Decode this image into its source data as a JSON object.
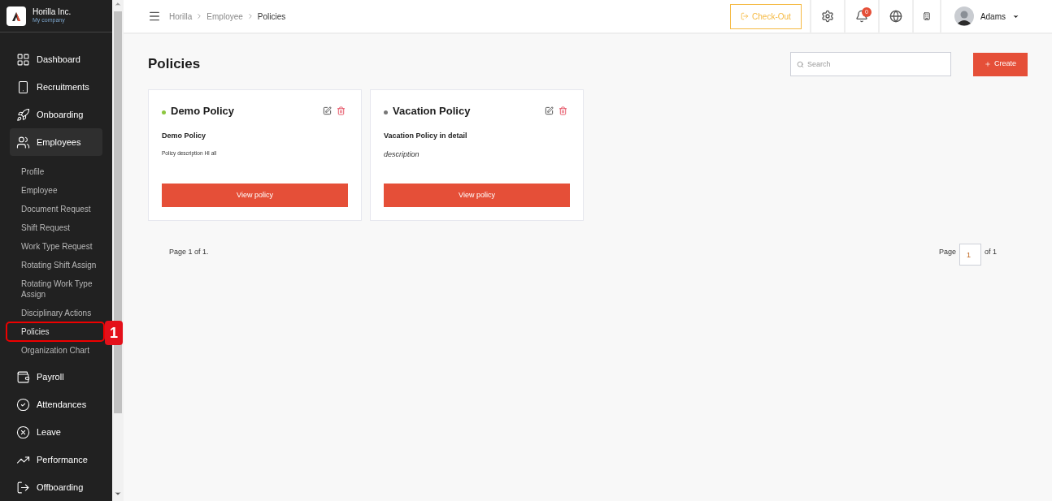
{
  "company": {
    "name": "Horilla Inc.",
    "subtitle": "My company"
  },
  "nav": [
    {
      "label": "Dashboard",
      "expanded": false
    },
    {
      "label": "Recruitments",
      "expanded": false
    },
    {
      "label": "Onboarding",
      "expanded": false
    },
    {
      "label": "Employees",
      "expanded": true,
      "children": [
        {
          "label": "Profile",
          "selected": false
        },
        {
          "label": "Employee",
          "selected": false
        },
        {
          "label": "Document Request",
          "selected": false
        },
        {
          "label": "Shift Request",
          "selected": false
        },
        {
          "label": "Work Type Request",
          "selected": false
        },
        {
          "label": "Rotating Shift Assign",
          "selected": false
        },
        {
          "label": "Rotating Work Type Assign",
          "selected": false
        },
        {
          "label": "Disciplinary Actions",
          "selected": false
        },
        {
          "label": "Policies",
          "selected": true,
          "callout": "1"
        },
        {
          "label": "Organization Chart",
          "selected": false
        }
      ]
    },
    {
      "label": "Payroll",
      "expanded": false
    },
    {
      "label": "Attendances",
      "expanded": false
    },
    {
      "label": "Leave",
      "expanded": false
    },
    {
      "label": "Performance",
      "expanded": false
    },
    {
      "label": "Offboarding",
      "expanded": false
    }
  ],
  "breadcrumb": [
    "Horilla",
    "Employee",
    "Policies"
  ],
  "checkout": "Check-Out",
  "notifications": "0",
  "user": "Adams",
  "page_title": "Policies",
  "search": {
    "placeholder": "Search"
  },
  "create": "Create",
  "policies": [
    {
      "title": "Demo Policy",
      "color": "#8cc63f",
      "heading": "Demo Policy",
      "description": "Policy description HI all",
      "kind": "plain",
      "button": "View policy"
    },
    {
      "title": "Vacation Policy",
      "color": "#777777",
      "heading": "Vacation Policy in detail",
      "description": "description",
      "kind": "italic",
      "button": "View policy"
    }
  ],
  "pagination": {
    "summary": "Page 1 of 1.",
    "label": "Page",
    "page": "1",
    "of": "of 1"
  }
}
